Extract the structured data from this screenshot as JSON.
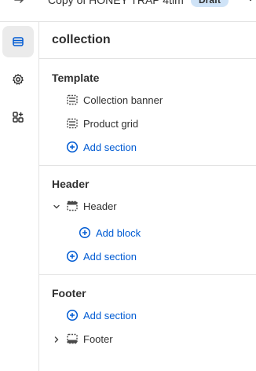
{
  "topbar": {
    "doc_title": "Copy of HONEY TRAP 4tim",
    "status_badge": "Draft"
  },
  "rail": {
    "items": [
      {
        "icon": "sections-icon",
        "active": true
      },
      {
        "icon": "gear-icon",
        "active": false
      },
      {
        "icon": "apps-icon",
        "active": false
      }
    ]
  },
  "panel": {
    "title": "collection",
    "template": {
      "heading": "Template",
      "sections": [
        "Collection banner",
        "Product grid"
      ],
      "add_section": "Add section"
    },
    "header": {
      "heading": "Header",
      "group_label": "Header",
      "add_block": "Add block",
      "add_section": "Add section"
    },
    "footer": {
      "heading": "Footer",
      "add_section": "Add section",
      "group_label": "Footer"
    }
  },
  "colors": {
    "accent": "#005bd3",
    "text": "#303030",
    "divider": "#e3e3e3",
    "active_rail": "#ebebeb",
    "badge_bg": "#cfe3f7"
  }
}
